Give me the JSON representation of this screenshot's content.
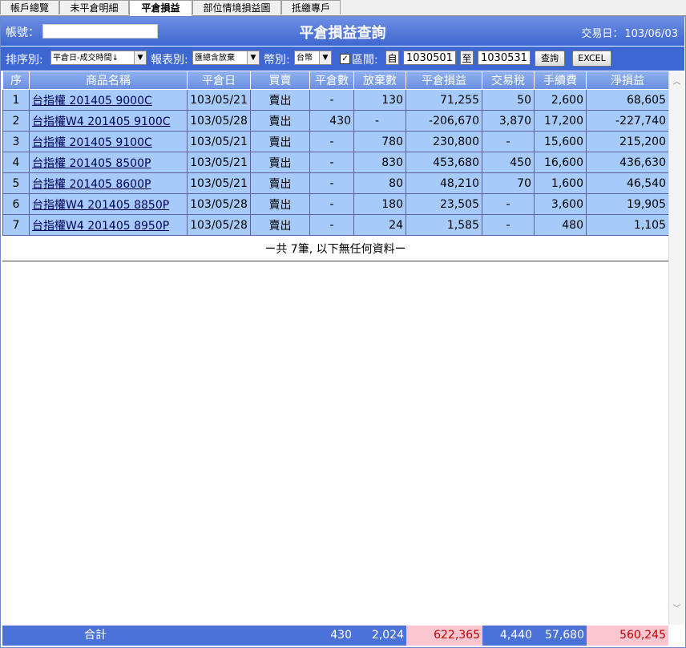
{
  "tabs": [
    "帳戶總覽",
    "未平倉明細",
    "平倉損益",
    "部位情境損益圖",
    "抵繳專戶"
  ],
  "active_tab": "平倉損益",
  "header": {
    "account_label": "帳號：",
    "account_value": "",
    "title": "平倉損益查詢",
    "trade_date_label": "交易日：",
    "trade_date": "103/06/03"
  },
  "filters": {
    "sort_label": "排序別:",
    "sort_value": "平倉日-成交時間↓",
    "report_label": "報表別:",
    "report_value": "匯總含放棄",
    "currency_label": "幣別:",
    "currency_value": "台幣",
    "range_label": "區間:",
    "from_label": "自",
    "from_value": "1030501",
    "to_label": "至",
    "to_value": "1030531",
    "query_button": "查詢",
    "excel_button": "EXCEL"
  },
  "table": {
    "columns": [
      "序",
      "商品名稱",
      "平倉日",
      "買賣",
      "平倉數",
      "放棄數",
      "平倉損益",
      "交易稅",
      "手續費",
      "淨損益"
    ],
    "rows": [
      [
        "1",
        "台指權 201405 9000C",
        "103/05/21",
        "賣出",
        "-",
        "130",
        "71,255",
        "50",
        "2,600",
        "68,605"
      ],
      [
        "2",
        "台指權W4 201405 9100C",
        "103/05/28",
        "賣出",
        "430",
        "-",
        "-206,670",
        "3,870",
        "17,200",
        "-227,740"
      ],
      [
        "3",
        "台指權 201405 9100C",
        "103/05/21",
        "賣出",
        "-",
        "780",
        "230,800",
        "-",
        "15,600",
        "215,200"
      ],
      [
        "4",
        "台指權 201405 8500P",
        "103/05/21",
        "賣出",
        "-",
        "830",
        "453,680",
        "450",
        "16,600",
        "436,630"
      ],
      [
        "5",
        "台指權 201405 8600P",
        "103/05/21",
        "賣出",
        "-",
        "80",
        "48,210",
        "70",
        "1,600",
        "46,540"
      ],
      [
        "6",
        "台指權W4 201405 8850P",
        "103/05/28",
        "賣出",
        "-",
        "180",
        "23,505",
        "-",
        "3,600",
        "19,905"
      ],
      [
        "7",
        "台指權W4 201405 8950P",
        "103/05/28",
        "賣出",
        "-",
        "24",
        "1,585",
        "-",
        "480",
        "1,105"
      ]
    ],
    "footnote": "ー共 7筆, 以下無任何資料ー"
  },
  "totals": {
    "label": "合計",
    "close_qty": "430",
    "abandon_qty": "2,024",
    "pnl": "622,365",
    "tax": "4,440",
    "fee": "57,680",
    "net": "560,245"
  },
  "colors": {
    "header_blue": "#3e66d0",
    "row_blue": "#a6cbfb",
    "total_pink": "#fbc6cf",
    "total_red_text": "#c00000"
  }
}
